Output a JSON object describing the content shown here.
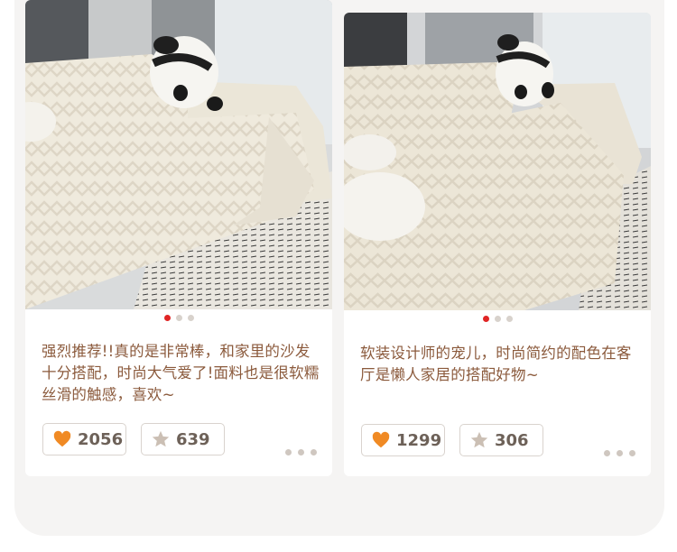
{
  "colors": {
    "accent_red": "#e02525",
    "heart_orange": "#f08a24",
    "star_gray": "#cbbfb4",
    "review_text": "#8b5a3c",
    "count_text": "#6d6158"
  },
  "reviews": [
    {
      "text": "强烈推荐!!真的是非常棒，和家里的沙发十分搭配，时尚大气爱了!面料也是很软糯丝滑的触感，喜欢~",
      "likes": "2056",
      "favorites": "639",
      "carousel": {
        "total": 3,
        "active": 1
      },
      "like_icon": "heart-icon",
      "favorite_icon": "star-icon",
      "more_icon": "more-dots-icon"
    },
    {
      "text": "软装设计师的宠儿，时尚简约的配色在客厅是懒人家居的搭配好物~",
      "likes": "1299",
      "favorites": "306",
      "carousel": {
        "total": 3,
        "active": 1
      },
      "like_icon": "heart-icon",
      "favorite_icon": "star-icon",
      "more_icon": "more-dots-icon"
    }
  ]
}
